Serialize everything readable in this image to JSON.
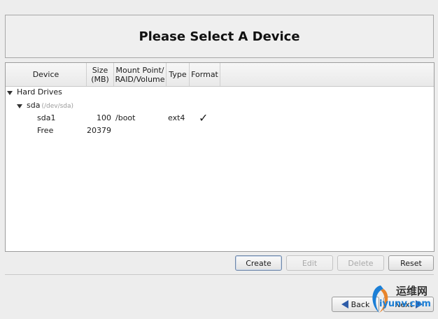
{
  "header": {
    "title": "Please Select A Device"
  },
  "columns": [
    {
      "l1": "Device",
      "l2": ""
    },
    {
      "l1": "Size",
      "l2": "(MB)"
    },
    {
      "l1": "Mount Point/",
      "l2": "RAID/Volume"
    },
    {
      "l1": "Type",
      "l2": ""
    },
    {
      "l1": "Format",
      "l2": ""
    }
  ],
  "tree": {
    "group_label": "Hard Drives",
    "disk_label": "sda",
    "disk_path": "(/dev/sda)",
    "rows": [
      {
        "device": "sda1",
        "size": "100",
        "mount": "/boot",
        "type": "ext4",
        "format": "✓"
      },
      {
        "device": "Free",
        "size": "20379",
        "mount": "",
        "type": "",
        "format": ""
      }
    ]
  },
  "buttons": {
    "create": "Create",
    "edit": "Edit",
    "delete": "Delete",
    "reset": "Reset",
    "back": "Back",
    "next": "Next"
  },
  "watermark": {
    "text": "运维网",
    "url": "iyunv.com"
  }
}
